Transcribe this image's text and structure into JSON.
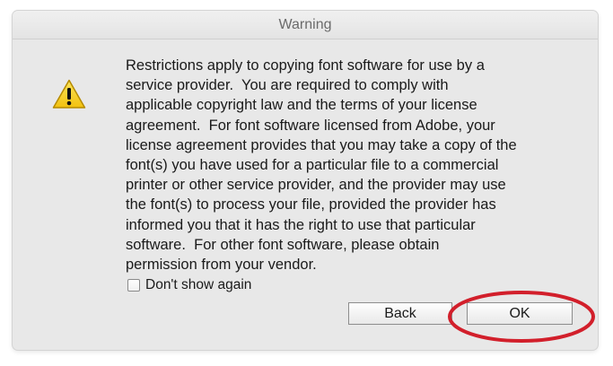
{
  "dialog": {
    "title": "Warning",
    "icon": "warning-triangle-icon",
    "message_lines": [
      "Restrictions apply to copying font software for use by a",
      "service provider.  You are required to comply with",
      "applicable copyright law and the terms of your license",
      "agreement.  For font software licensed from Adobe, your",
      "license agreement provides that you may take a copy of the",
      "font(s) you have used for a particular file to a commercial",
      "printer or other service provider, and the provider may use",
      "the font(s) to process your file, provided the provider has",
      "informed you that it has the right to use that particular",
      "software.  For other font software, please obtain",
      "permission from your vendor."
    ],
    "checkbox": {
      "label": "Don't show again",
      "checked": false
    },
    "buttons": {
      "back": "Back",
      "ok": "OK"
    }
  },
  "colors": {
    "dialog_bg": "#e8e8e8",
    "warning_yellow": "#f6d12a",
    "highlight_red": "#d21f2b"
  }
}
